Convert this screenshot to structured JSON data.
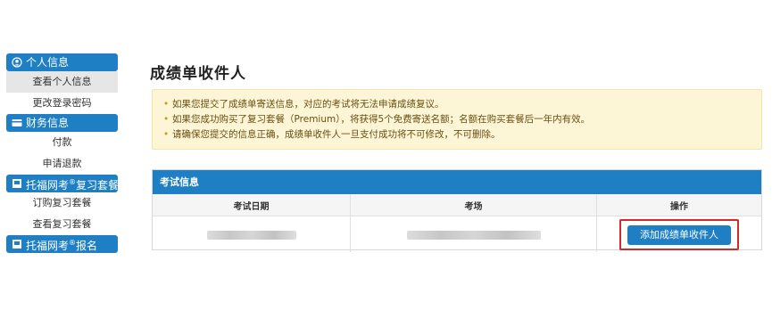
{
  "sidebar": {
    "sections": [
      {
        "label": "个人信息",
        "icon": "user-circle-icon",
        "items": [
          "查看个人信息",
          "更改登录密码"
        ]
      },
      {
        "label": "财务信息",
        "icon": "card-icon",
        "items": [
          "付款",
          "申请退款"
        ]
      },
      {
        "label_prefix": "托福网考",
        "label_sup": "®",
        "label_suffix": "复习套餐",
        "icon": "book-icon",
        "items": [
          "订购复习套餐",
          "查看复习套餐"
        ]
      },
      {
        "label_prefix": "托福网考",
        "label_sup": "®",
        "label_suffix": "报名",
        "icon": "book-icon"
      }
    ]
  },
  "page": {
    "title": "成绩单收件人"
  },
  "notice": {
    "lines": [
      "如果您提交了成绩单寄送信息，对应的考试将无法申请成绩复议。",
      "如果您成功购买了复习套餐（Premium），将获得5个免费寄送名额；名额在购买套餐后一年内有效。",
      "请确保您提交的信息正确，成绩单收件人一旦支付成功将不可修改，不可删除。"
    ]
  },
  "exam_panel": {
    "title": "考试信息",
    "columns": [
      "考试日期",
      "考场",
      "操作"
    ],
    "action_label": "添加成绩单收件人"
  },
  "colors": {
    "accent": "#1e7fc4",
    "notice_bg": "#fdf6d6",
    "highlight": "#d12a2a"
  }
}
